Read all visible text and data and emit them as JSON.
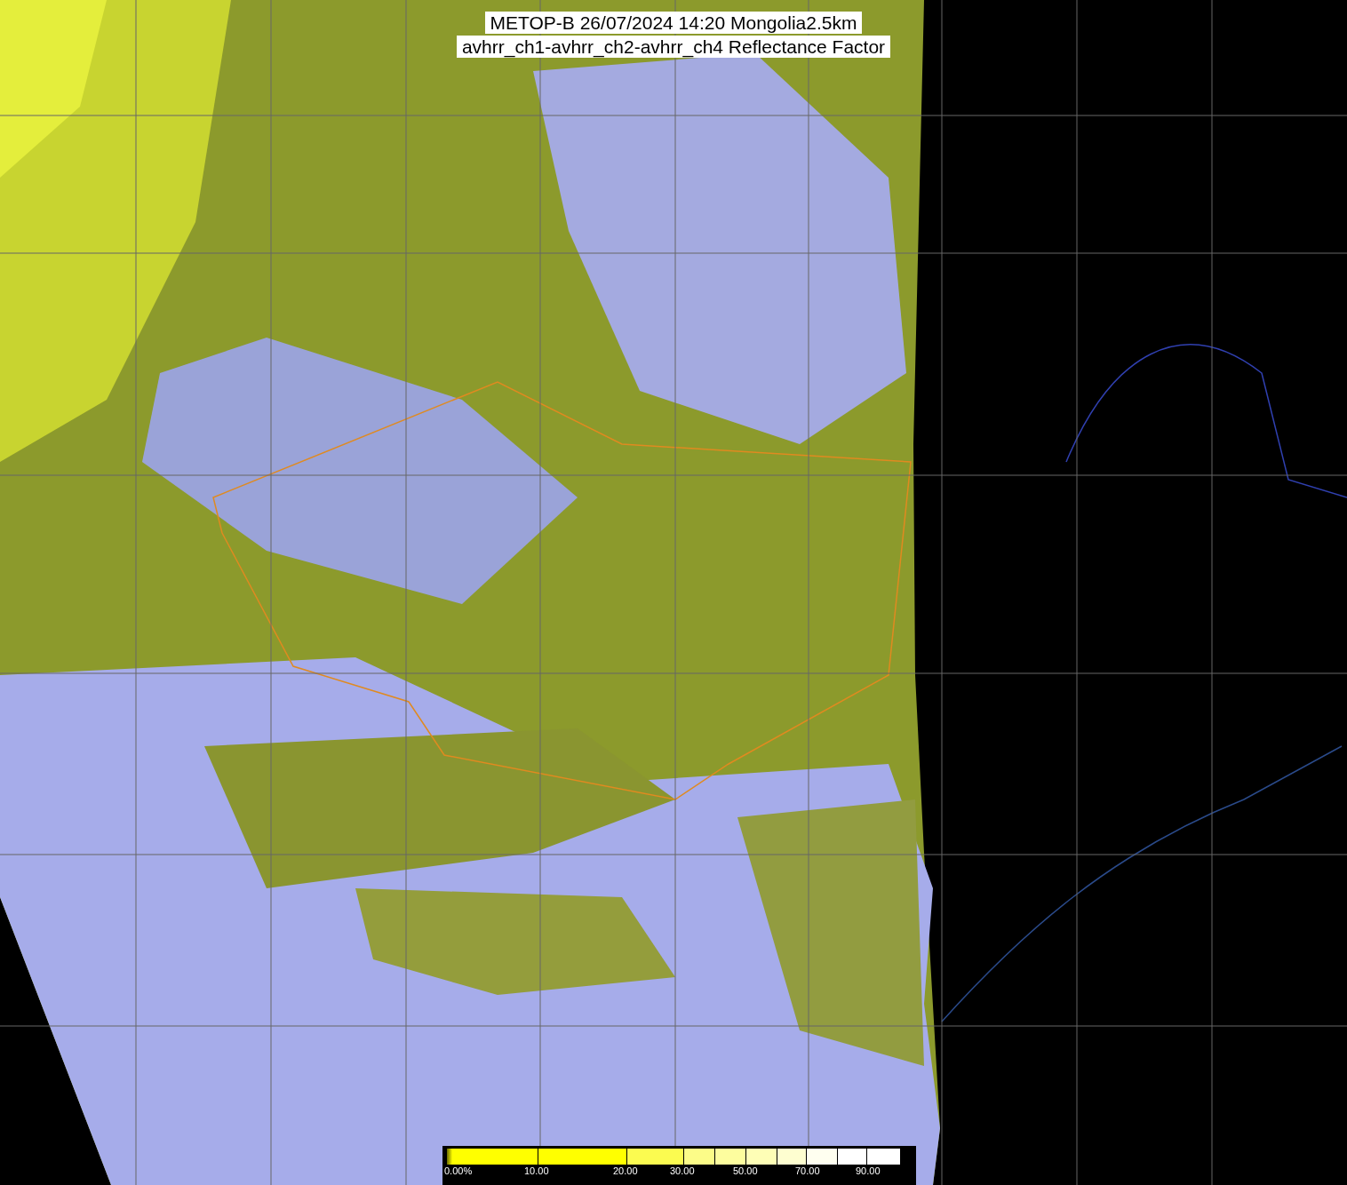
{
  "title": {
    "lines": [
      "METOP-B 26/07/2024 14:20 Mongolia2.5km",
      "avhrr_ch1-avhrr_ch2-avhrr_ch4 Reflectance Factor"
    ]
  },
  "colorbar": {
    "labels": [
      "0.00%",
      "10.00",
      "20.00",
      "30.00",
      "50.00",
      "70.00",
      "90.00"
    ]
  }
}
